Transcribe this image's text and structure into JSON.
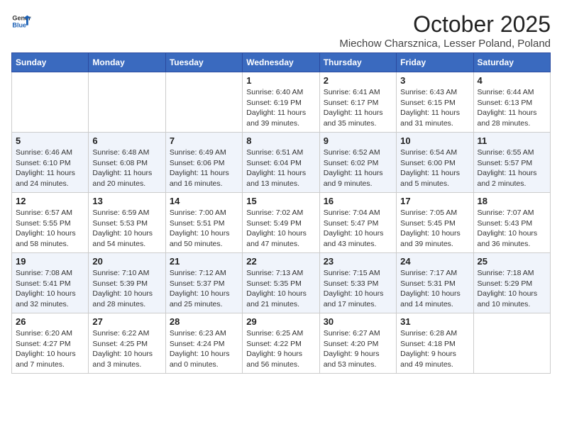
{
  "header": {
    "logo_general": "General",
    "logo_blue": "Blue",
    "month_title": "October 2025",
    "subtitle": "Miechow Charsznica, Lesser Poland, Poland"
  },
  "days_of_week": [
    "Sunday",
    "Monday",
    "Tuesday",
    "Wednesday",
    "Thursday",
    "Friday",
    "Saturday"
  ],
  "weeks": [
    {
      "days": [
        {
          "num": "",
          "info": ""
        },
        {
          "num": "",
          "info": ""
        },
        {
          "num": "",
          "info": ""
        },
        {
          "num": "1",
          "info": "Sunrise: 6:40 AM\nSunset: 6:19 PM\nDaylight: 11 hours and 39 minutes."
        },
        {
          "num": "2",
          "info": "Sunrise: 6:41 AM\nSunset: 6:17 PM\nDaylight: 11 hours and 35 minutes."
        },
        {
          "num": "3",
          "info": "Sunrise: 6:43 AM\nSunset: 6:15 PM\nDaylight: 11 hours and 31 minutes."
        },
        {
          "num": "4",
          "info": "Sunrise: 6:44 AM\nSunset: 6:13 PM\nDaylight: 11 hours and 28 minutes."
        }
      ]
    },
    {
      "days": [
        {
          "num": "5",
          "info": "Sunrise: 6:46 AM\nSunset: 6:10 PM\nDaylight: 11 hours and 24 minutes."
        },
        {
          "num": "6",
          "info": "Sunrise: 6:48 AM\nSunset: 6:08 PM\nDaylight: 11 hours and 20 minutes."
        },
        {
          "num": "7",
          "info": "Sunrise: 6:49 AM\nSunset: 6:06 PM\nDaylight: 11 hours and 16 minutes."
        },
        {
          "num": "8",
          "info": "Sunrise: 6:51 AM\nSunset: 6:04 PM\nDaylight: 11 hours and 13 minutes."
        },
        {
          "num": "9",
          "info": "Sunrise: 6:52 AM\nSunset: 6:02 PM\nDaylight: 11 hours and 9 minutes."
        },
        {
          "num": "10",
          "info": "Sunrise: 6:54 AM\nSunset: 6:00 PM\nDaylight: 11 hours and 5 minutes."
        },
        {
          "num": "11",
          "info": "Sunrise: 6:55 AM\nSunset: 5:57 PM\nDaylight: 11 hours and 2 minutes."
        }
      ]
    },
    {
      "days": [
        {
          "num": "12",
          "info": "Sunrise: 6:57 AM\nSunset: 5:55 PM\nDaylight: 10 hours and 58 minutes."
        },
        {
          "num": "13",
          "info": "Sunrise: 6:59 AM\nSunset: 5:53 PM\nDaylight: 10 hours and 54 minutes."
        },
        {
          "num": "14",
          "info": "Sunrise: 7:00 AM\nSunset: 5:51 PM\nDaylight: 10 hours and 50 minutes."
        },
        {
          "num": "15",
          "info": "Sunrise: 7:02 AM\nSunset: 5:49 PM\nDaylight: 10 hours and 47 minutes."
        },
        {
          "num": "16",
          "info": "Sunrise: 7:04 AM\nSunset: 5:47 PM\nDaylight: 10 hours and 43 minutes."
        },
        {
          "num": "17",
          "info": "Sunrise: 7:05 AM\nSunset: 5:45 PM\nDaylight: 10 hours and 39 minutes."
        },
        {
          "num": "18",
          "info": "Sunrise: 7:07 AM\nSunset: 5:43 PM\nDaylight: 10 hours and 36 minutes."
        }
      ]
    },
    {
      "days": [
        {
          "num": "19",
          "info": "Sunrise: 7:08 AM\nSunset: 5:41 PM\nDaylight: 10 hours and 32 minutes."
        },
        {
          "num": "20",
          "info": "Sunrise: 7:10 AM\nSunset: 5:39 PM\nDaylight: 10 hours and 28 minutes."
        },
        {
          "num": "21",
          "info": "Sunrise: 7:12 AM\nSunset: 5:37 PM\nDaylight: 10 hours and 25 minutes."
        },
        {
          "num": "22",
          "info": "Sunrise: 7:13 AM\nSunset: 5:35 PM\nDaylight: 10 hours and 21 minutes."
        },
        {
          "num": "23",
          "info": "Sunrise: 7:15 AM\nSunset: 5:33 PM\nDaylight: 10 hours and 17 minutes."
        },
        {
          "num": "24",
          "info": "Sunrise: 7:17 AM\nSunset: 5:31 PM\nDaylight: 10 hours and 14 minutes."
        },
        {
          "num": "25",
          "info": "Sunrise: 7:18 AM\nSunset: 5:29 PM\nDaylight: 10 hours and 10 minutes."
        }
      ]
    },
    {
      "days": [
        {
          "num": "26",
          "info": "Sunrise: 6:20 AM\nSunset: 4:27 PM\nDaylight: 10 hours and 7 minutes."
        },
        {
          "num": "27",
          "info": "Sunrise: 6:22 AM\nSunset: 4:25 PM\nDaylight: 10 hours and 3 minutes."
        },
        {
          "num": "28",
          "info": "Sunrise: 6:23 AM\nSunset: 4:24 PM\nDaylight: 10 hours and 0 minutes."
        },
        {
          "num": "29",
          "info": "Sunrise: 6:25 AM\nSunset: 4:22 PM\nDaylight: 9 hours and 56 minutes."
        },
        {
          "num": "30",
          "info": "Sunrise: 6:27 AM\nSunset: 4:20 PM\nDaylight: 9 hours and 53 minutes."
        },
        {
          "num": "31",
          "info": "Sunrise: 6:28 AM\nSunset: 4:18 PM\nDaylight: 9 hours and 49 minutes."
        },
        {
          "num": "",
          "info": ""
        }
      ]
    }
  ]
}
